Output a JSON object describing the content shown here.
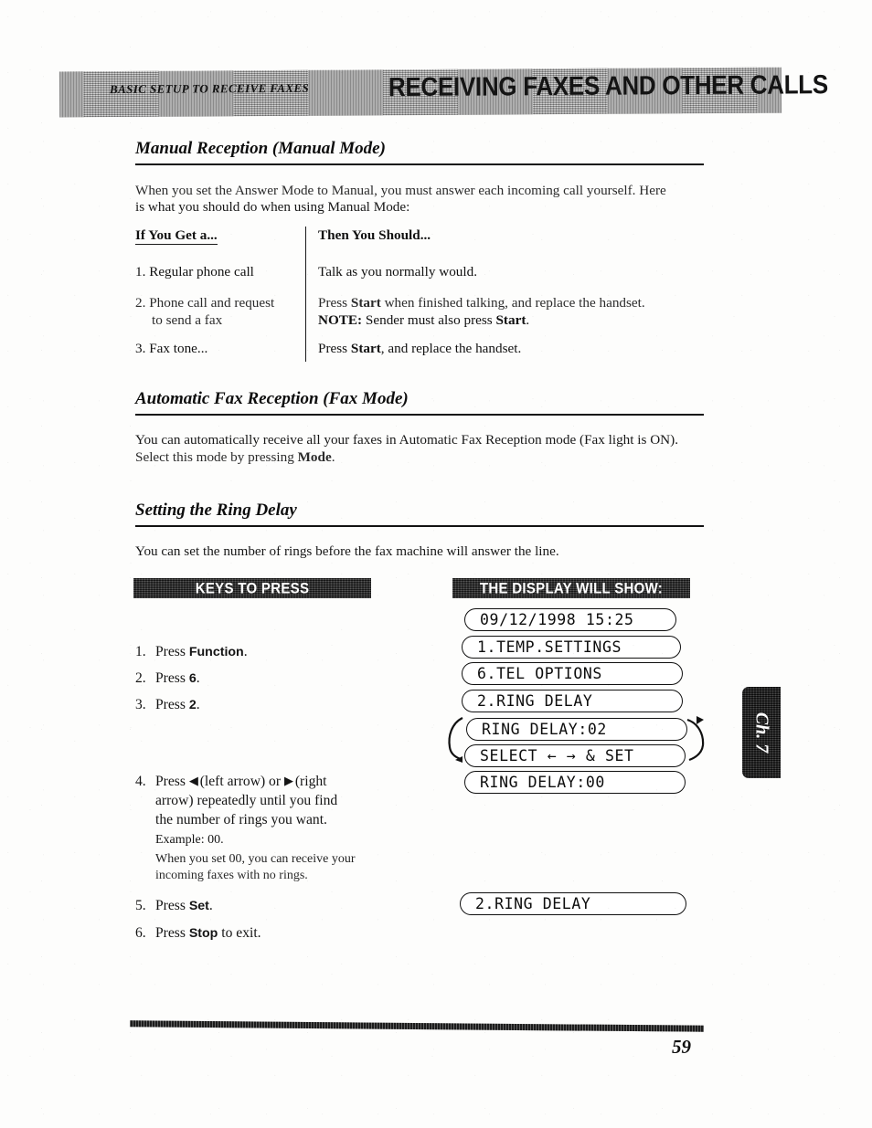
{
  "header": {
    "left_title": "BASIC SETUP TO RECEIVE FAXES",
    "right_title": "RECEIVING FAXES AND OTHER CALLS"
  },
  "sections": {
    "manual": {
      "heading": "Manual Reception (Manual Mode)",
      "intro_line1": "When you set the Answer Mode to Manual, you must answer each incoming call yourself.  Here",
      "intro_line2": "is what you should do when using Manual Mode:"
    },
    "automatic": {
      "heading": "Automatic Fax Reception (Fax Mode)",
      "body_line1": "You can automatically receive all your faxes in Automatic Fax Reception mode (Fax light is ON).",
      "body_line2_pre": "Select this mode by pressing ",
      "body_line2_bold": "Mode",
      "body_line2_post": "."
    },
    "ring_delay": {
      "heading": "Setting the Ring Delay",
      "body": "You can set the number of rings before the fax machine will answer the line."
    }
  },
  "table": {
    "col1_header": "If You Get a...",
    "col2_header": "Then You Should...",
    "rows": [
      {
        "num": "1.",
        "condition": "Regular phone call",
        "action": "Talk as you normally would."
      },
      {
        "num": "2.",
        "condition_line1": "Phone call and request",
        "condition_line2": "to send a fax",
        "action_line1_pre": "Press ",
        "action_line1_bold": "Start",
        "action_line1_post": " when finished talking, and replace the handset.",
        "action_line2_bold": "NOTE:",
        "action_line2_pre": "  Sender must also press ",
        "action_line2_bold2": "Start",
        "action_line2_post": "."
      },
      {
        "num": "3.",
        "condition": "Fax tone...",
        "action_pre": "Press ",
        "action_bold": "Start",
        "action_post": ", and replace the handset."
      }
    ]
  },
  "procedure": {
    "keys_bar": "KEYS TO PRESS",
    "display_bar": "THE DISPLAY WILL SHOW:",
    "steps": [
      {
        "num": "1.",
        "pre": "Press ",
        "key": "Function",
        "post": "."
      },
      {
        "num": "2.",
        "pre": "Press ",
        "key": "6",
        "post": "."
      },
      {
        "num": "3.",
        "pre": "Press ",
        "key": "2",
        "post": "."
      },
      {
        "num": "4.",
        "line1_pre": "Press ",
        "left_arrow_glyph": "◀",
        "line1_mid": " (left arrow) or ",
        "right_arrow_glyph": "▶",
        "line1_post": " (right",
        "line2": "arrow) repeatedly until you find",
        "line3": "the number of rings you want.",
        "line4": "Example: 00.",
        "note_line1": "When you set 00, you can receive your",
        "note_line2": "incoming faxes with no rings."
      },
      {
        "num": "5.",
        "pre": "Press ",
        "key": "Set",
        "post": "."
      },
      {
        "num": "6.",
        "pre": "Press ",
        "key": "Stop",
        "post": " to exit."
      }
    ],
    "displays": [
      "09/12/1998 15:25",
      "1.TEMP.SETTINGS",
      "6.TEL OPTIONS",
      "2.RING DELAY",
      "RING DELAY:02",
      "SELECT ← → & SET",
      "RING DELAY:00"
    ],
    "final_display": "2.RING DELAY"
  },
  "chapter_tab": "Ch. 7",
  "page_number": "59"
}
